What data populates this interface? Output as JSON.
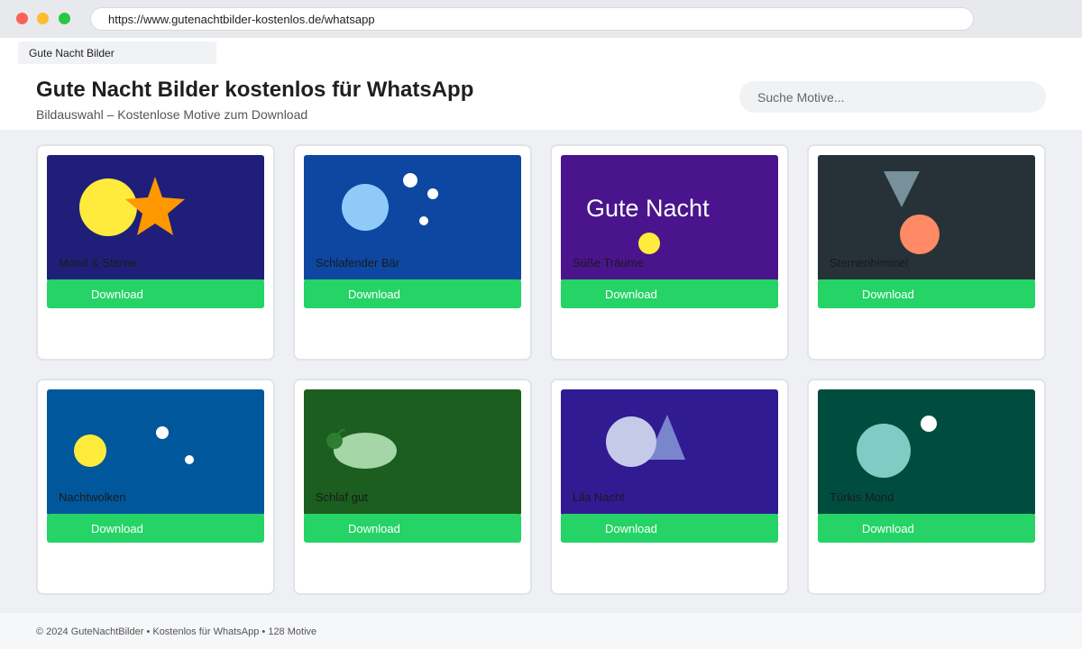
{
  "browser": {
    "url": "https://www.gutenachtbilder-kostenlos.de/whatsapp",
    "tab_title": "Gute Nacht Bilder"
  },
  "header": {
    "title": "Gute Nacht Bilder kostenlos für WhatsApp",
    "subtitle": "Bildauswahl – Kostenlose Motive zum Download",
    "search_placeholder": "Suche Motive..."
  },
  "colors": {
    "download_button": "#25d366",
    "page_background": "#eef0f3"
  },
  "cards": [
    {
      "caption": "Mond & Sterne",
      "button": "Download",
      "background": "#1f1f7a",
      "icons": [
        "moon-icon",
        "star-icon"
      ]
    },
    {
      "caption": "Schlafender Bär",
      "button": "Download",
      "background": "#0d47a1",
      "icons": [
        "bear-face-icon",
        "bubble-icon"
      ]
    },
    {
      "caption": "Süße Träume",
      "button": "Download",
      "background": "#4a148c",
      "overlay_text": "Gute Nacht",
      "icons": [
        "dot-icon"
      ]
    },
    {
      "caption": "Sternenhimmel",
      "button": "Download",
      "background": "#263238",
      "icons": [
        "triangle-icon",
        "circle-icon"
      ]
    },
    {
      "caption": "Nachtwolken",
      "button": "Download",
      "background": "#01579b",
      "icons": [
        "moon-icon",
        "star-dot-icon"
      ]
    },
    {
      "caption": "Schlaf gut",
      "button": "Download",
      "background": "#1b5e20",
      "icons": [
        "leaf-icon"
      ]
    },
    {
      "caption": "Lila Nacht",
      "button": "Download",
      "background": "#311b92",
      "icons": [
        "circle-icon",
        "triangle-icon"
      ]
    },
    {
      "caption": "Türkis Mond",
      "button": "Download",
      "background": "#004d40",
      "icons": [
        "moon-icon",
        "star-dot-icon"
      ]
    }
  ],
  "footer": {
    "text": "© 2024 GuteNachtBilder • Kostenlos für WhatsApp • 128 Motive"
  }
}
